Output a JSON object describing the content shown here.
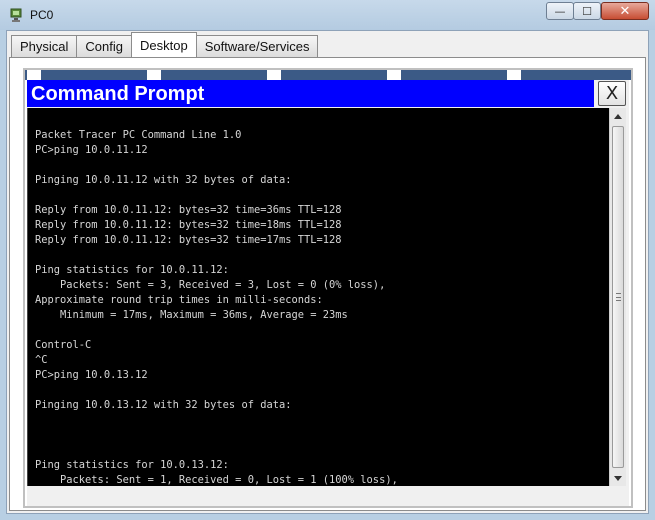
{
  "window": {
    "title": "PC0",
    "min_glyph": "—",
    "max_glyph": "☐",
    "close_glyph": "✕"
  },
  "tabs": [
    {
      "label": "Physical",
      "active": false
    },
    {
      "label": "Config",
      "active": false
    },
    {
      "label": "Desktop",
      "active": true
    },
    {
      "label": "Software/Services",
      "active": false
    }
  ],
  "command_prompt": {
    "title": "Command Prompt",
    "close_label": "X",
    "lines": [
      "Packet Tracer PC Command Line 1.0",
      "PC>ping 10.0.11.12",
      "",
      "Pinging 10.0.11.12 with 32 bytes of data:",
      "",
      "Reply from 10.0.11.12: bytes=32 time=36ms TTL=128",
      "Reply from 10.0.11.12: bytes=32 time=18ms TTL=128",
      "Reply from 10.0.11.12: bytes=32 time=17ms TTL=128",
      "",
      "Ping statistics for 10.0.11.12:",
      "    Packets: Sent = 3, Received = 3, Lost = 0 (0% loss),",
      "Approximate round trip times in milli-seconds:",
      "    Minimum = 17ms, Maximum = 36ms, Average = 23ms",
      "",
      "Control-C",
      "^C",
      "PC>ping 10.0.13.12",
      "",
      "Pinging 10.0.13.12 with 32 bytes of data:",
      "",
      "",
      "",
      "Ping statistics for 10.0.13.12:",
      "    Packets: Sent = 1, Received = 0, Lost = 1 (100% loss),"
    ]
  },
  "colors": {
    "cmd_title_bg": "#0000ff",
    "terminal_bg": "#000000",
    "terminal_fg": "#d6d6d6"
  },
  "icons": {
    "app": "packet-tracer-pc-icon",
    "scroll_up": "triangle-up-icon",
    "scroll_down": "triangle-down-icon"
  }
}
